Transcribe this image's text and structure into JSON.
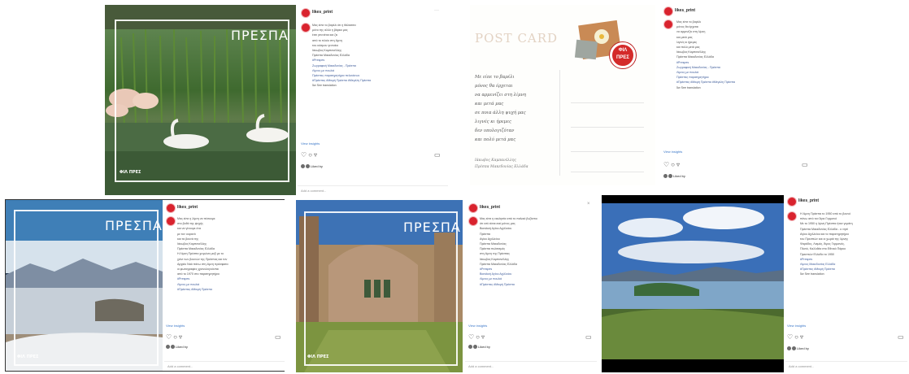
{
  "account": {
    "username": "likes_print",
    "avatar_color": "#d9232e"
  },
  "ui": {
    "view_more": "View insights",
    "likes_text": "Liked by",
    "comment_placeholder": "Add a comment...",
    "action_icons": [
      "heart-icon",
      "comment-icon",
      "share-icon"
    ],
    "save_icon": "bookmark-icon",
    "options_icon": "more-dots-icon"
  },
  "posts": [
    {
      "image_title": "ΠΡΕΣΠΑ",
      "logo_text": "ΦΙΛ ΠΡΕΣ",
      "caption": [
        "Μας είπε το βαρέλι ότι η θάλασσα",
        "μόνο της αλλά η βάρκα μας",
        "έτσι γεννιέται και ζει",
        "από το πλοίο στη λίμνη",
        "του κόσμου γενναίοι",
        "",
        "Ιάκωβος Καμπανέλλης",
        "Πρέσπα Μακεδονίας Ελλάδα",
        "",
        "#Prespes",
        "",
        "Ζωγραφική Μακεδονίας - Πρέσπα",
        "",
        "Λίμνες με πουλιά",
        "Πρέσπες παρατηρητήριο πελεκάνων",
        "#Πρέσπες #Μικρή Πρέσπα #Μεγάλη Πρέσπα",
        "",
        "5w  See translation"
      ]
    },
    {
      "postcard_title": "POST CARD",
      "stamp_text": "ΦΙΛ ΠΡΕΣ",
      "poem": [
        "Με είπε το βαρέλι",
        "μόνος θα έρχεται",
        "να αρμενίζει στη λίμνη",
        "και μετά μας",
        "σε ποια άλλη ψυχή μας",
        "λιγνές κι ήρεμες",
        "δεν υπολογιζόταν",
        "και πολύ μετά μας"
      ],
      "signature": [
        "Ιάκωβος Καμπανέλλης",
        "Πρέσπα Μακεδονίας Ελλάδα"
      ],
      "caption": [
        "Μας είπε το βαρέλι",
        "μόνος θα έρχεται",
        "να αρμενίζει στη λίμνη",
        "και μετά μας",
        "λιγνές κι ήρεμες",
        "και πολύ μετά μας",
        "",
        "Ιάκωβος Καμπανέλλης",
        "Πρέσπα Μακεδονίας Ελλάδα",
        "",
        "#Prespes",
        "",
        "Ζωγραφική Μακεδονίας - Πρέσπα",
        "",
        "Λίμνες με πουλιά",
        "Πρέσπες παρατηρητήριο",
        "#Πρέσπες #Μικρή Πρέσπα #Μεγάλη Πρέσπα",
        "",
        "5w  See translation"
      ]
    },
    {
      "image_title": "ΠΡΕΣΠΑ",
      "logo_text": "ΦΙΛ ΠΡΕΣ",
      "caption": [
        "Μας είπε η λίμνη να πέσουμε",
        "στο βυθό της ψυχής",
        "και να γίνουμε ένα",
        "με τον ουρανό",
        "και τα βουνά της",
        "",
        "Ιάκωβος Καμπανέλλης",
        "Πρέσπα Μακεδονίας Ελλάδα",
        "",
        "Η Λίμνη Πρέσπα χειμώνα μαζί με το",
        "χιόνι των βουνών της Πρέσπας και τον",
        "Αρχαίο Ναό πάνω στη λίμνη πρόσφατα",
        "οι φωτογραφίες χρονολογούνται",
        "από το 1970 στο παρατηρητήριο",
        "",
        "#Prespes",
        "Λίμνες με πουλιά",
        "#Πρέσπες #Μικρή Πρέσπα"
      ]
    },
    {
      "image_title": "ΠΡΕΣΠΑ",
      "logo_text": "ΦΙΛ ΠΡΕΣ",
      "caption": [
        "Μας είπε η εκκλησία από το παλαιό βυζάντιο",
        "ότι εσύ είσαι εκεί μόνος μας",
        "Βασιλική Αγίου Αχιλλείου",
        "Πρέσπα",
        "",
        "Αγίου Αχιλλείου",
        "Πρέσπα Μακεδονίας",
        "Πρέσπα πολιτισμός",
        "στη λίμνη της Πρέσπας",
        "",
        "Ιάκωβος Καμπανέλλης",
        "Πρέσπα Μακεδονίας Ελλάδα",
        "",
        "#Prespes",
        "Βασιλική Αγίου Αχιλλείου",
        "Λίμνες με πουλιά",
        "#Πρέσπες #Μικρή Πρέσπα"
      ]
    },
    {
      "caption": [
        "Η λίμνη Πρέσπα το 1950 από το βουνό",
        "πάνω από τον Άγιο Γερμανό",
        "",
        "Με το 1950 η λίμνη Πρέσπα ήταν γεμάτη",
        "Πρέσπα Μακεδονίας Ελλάδα - ο νησί",
        "Αγίου Αχιλλείου και το παρατηρητήριο",
        "του Πρεσπών και οι χωριά της λίμνης",
        "Ψαράδες, Λαιμός, Άγιος Γερμανός,",
        "Πλατύ, Καλλιθέα στο Εθνικό Πάρκο",
        "Πρεσπών Ελλάδα το 1950",
        "",
        "#Prespes",
        "Λίμνες Μακεδονίας Ελλάδα",
        "#Πρέσπες #Μικρή Πρέσπα",
        "",
        "5w  See translation"
      ]
    }
  ],
  "colors": {
    "link": "#3b77c8",
    "hashtag": "#3b5998",
    "frame": "#ffffff",
    "photo_bg": "#1a1a1a"
  }
}
